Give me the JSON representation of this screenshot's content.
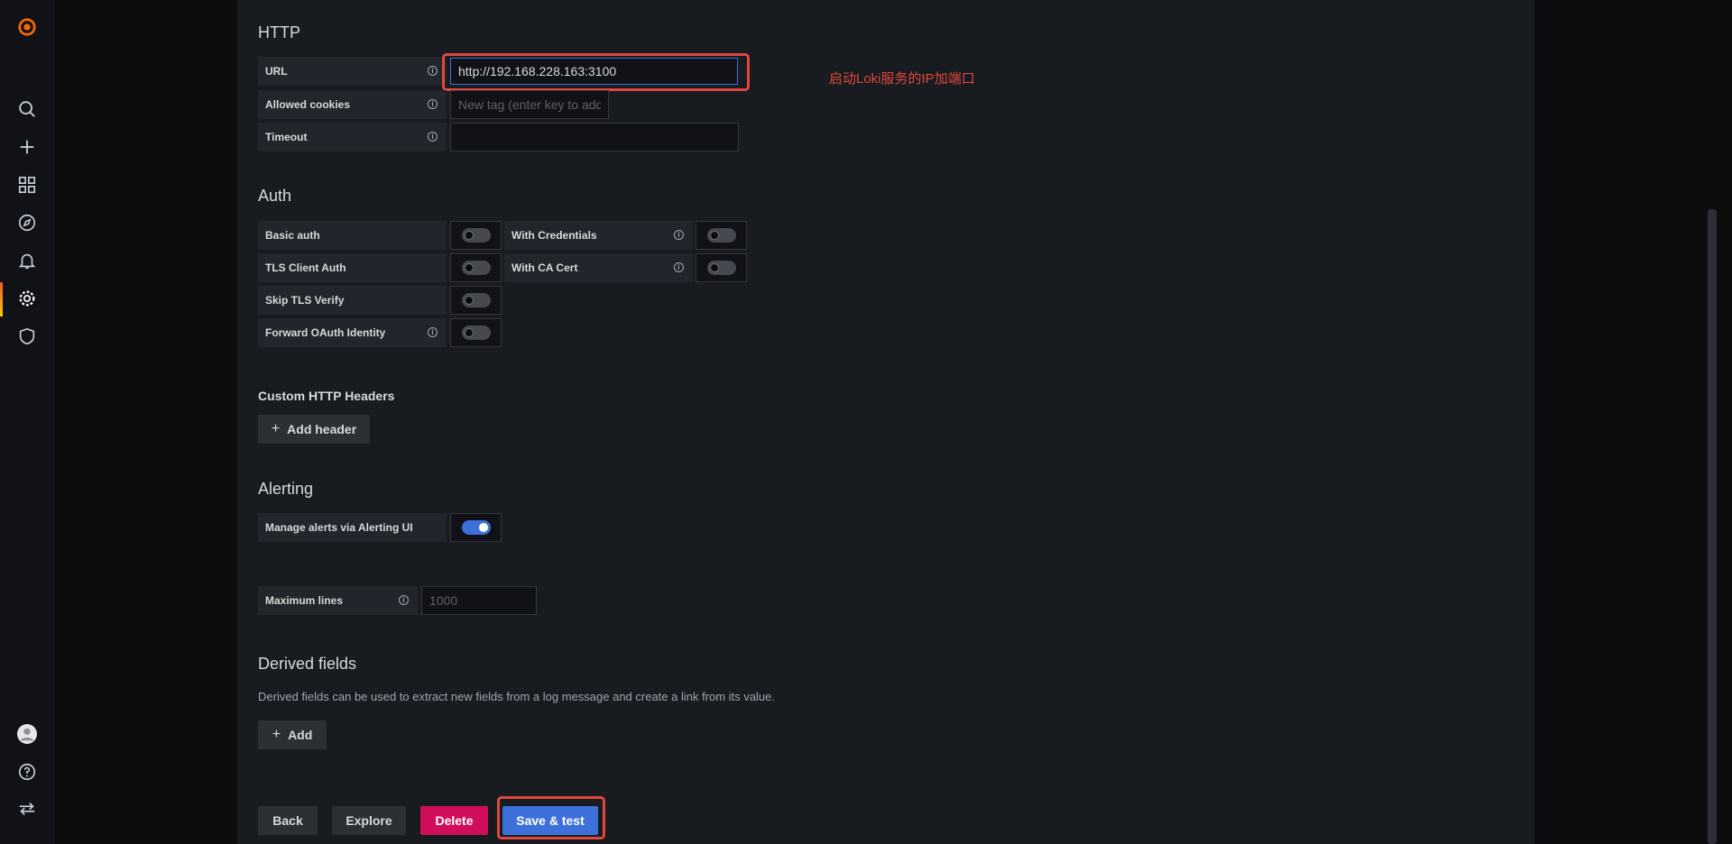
{
  "sidebar": {
    "logo": "grafana-logo",
    "top_items": [
      "search-icon",
      "plus-icon",
      "dashboards-icon",
      "explore-icon",
      "alerting-bell-icon",
      "gear-icon",
      "shield-icon"
    ],
    "bottom_items": [
      "avatar",
      "help-icon",
      "switch-icon"
    ]
  },
  "http": {
    "title": "HTTP",
    "url_label": "URL",
    "url_value": "http://192.168.228.163:3100",
    "allowed_cookies_label": "Allowed cookies",
    "allowed_cookies_placeholder": "New tag (enter key to add",
    "timeout_label": "Timeout",
    "timeout_value": ""
  },
  "annotation": {
    "text": "启动Loki服务的IP加端口",
    "color": "#e0483d"
  },
  "auth": {
    "title": "Auth",
    "basic_auth": "Basic auth",
    "with_credentials": "With Credentials",
    "tls_client_auth": "TLS Client Auth",
    "with_ca_cert": "With CA Cert",
    "skip_tls_verify": "Skip TLS Verify",
    "forward_oauth": "Forward OAuth Identity"
  },
  "custom_headers": {
    "title": "Custom HTTP Headers",
    "add_label": "Add header"
  },
  "alerting": {
    "title": "Alerting",
    "manage_label": "Manage alerts via Alerting UI",
    "manage_enabled": true
  },
  "max_lines": {
    "label": "Maximum lines",
    "placeholder": "1000"
  },
  "derived_fields": {
    "title": "Derived fields",
    "description": "Derived fields can be used to extract new fields from a log message and create a link from its value.",
    "add_label": "Add"
  },
  "actions": {
    "back": "Back",
    "explore": "Explore",
    "delete": "Delete",
    "save_test": "Save & test"
  },
  "colors": {
    "primary": "#3d71d9",
    "danger": "#d10e5c",
    "highlight": "#e0483d"
  }
}
